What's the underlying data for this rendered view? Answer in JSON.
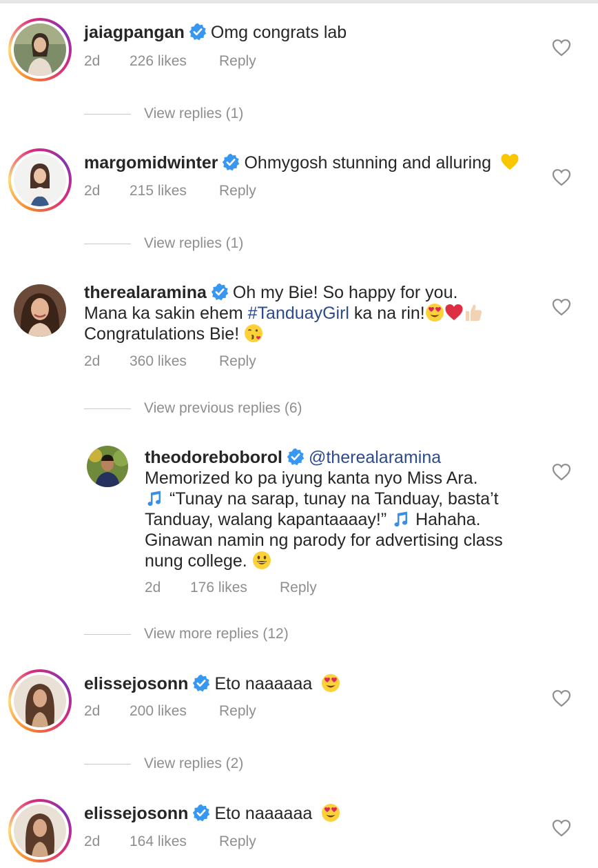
{
  "comments": [
    {
      "username": "jaiagpangan",
      "text": "Omg congrats lab",
      "age": "2d",
      "likes": "226 likes",
      "reply": "Reply",
      "view_replies": "View replies (1)"
    },
    {
      "username": "margomidwinter",
      "text": "Ohmygosh stunning and alluring",
      "age": "2d",
      "likes": "215 likes",
      "reply": "Reply",
      "view_replies": "View replies (1)"
    },
    {
      "username": "therealaramina",
      "text_part1": "Oh my Bie! So happy for you.",
      "text_part2": "Mana ka sakin ehem",
      "hashtag": "#TanduayGirl",
      "text_part3": "ka na rin!",
      "text_part4": "Congratulations Bie!",
      "age": "2d",
      "likes": "360 likes",
      "reply": "Reply",
      "view_previous": "View previous replies (6)",
      "view_more": "View more replies (12)"
    },
    {
      "username": "elissejosonn",
      "text": "Eto naaaaaa",
      "age": "2d",
      "likes": "200 likes",
      "reply": "Reply",
      "view_replies": "View replies (2)"
    },
    {
      "username": "elissejosonn",
      "text": "Eto naaaaaa",
      "age": "2d",
      "likes": "164 likes",
      "reply": "Reply"
    }
  ],
  "reply": {
    "username": "theodoreboborol",
    "mention": "@therealaramina",
    "line1": "Memorized ko pa iyung kanta nyo Miss Ara.",
    "line2": "“Tunay na sarap, tunay na Tanduay, basta’t",
    "line3a": "Tanduay, walang kapantaaaay!”",
    "line3b": "Hahaha.",
    "line4": "Ginawan namin ng parody for advertising class",
    "line5": "nung college.",
    "age": "2d",
    "likes": "176 likes",
    "reply": "Reply"
  },
  "icons": {
    "verified": "verified-badge-icon",
    "heart": "heart-outline-icon",
    "music": "music-note-icon"
  },
  "colors": {
    "verified": "#3897f0",
    "link": "#2d4a8c",
    "meta": "#8e8e8e",
    "text": "#262626"
  }
}
